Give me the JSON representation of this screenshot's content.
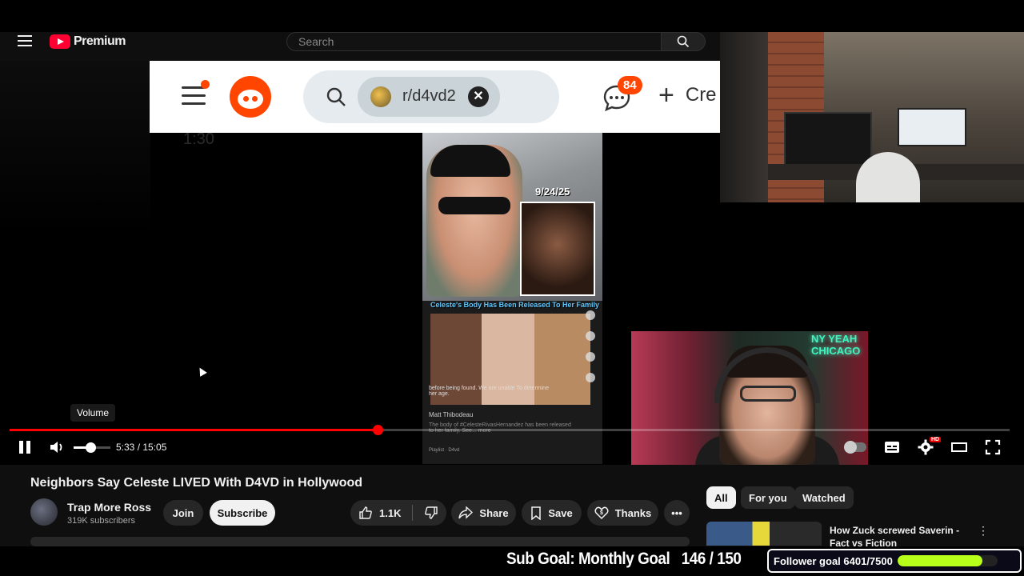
{
  "youtube": {
    "logo_text": "Premium",
    "search_placeholder": "Search"
  },
  "reddit": {
    "chip_label": "r/d4vd2",
    "notification_count": "84",
    "create_label": "Cre"
  },
  "video": {
    "ghost_time": "1:30",
    "tiktok": {
      "date": "9/24/25",
      "caption": "Celeste's Body Has Been Released To Her Family",
      "text_overlay": "before being found. We are unable To determine her age.",
      "username": "Matt Thibodeau",
      "body": "The body of #CelesteRivasHernandez has been released to her family. See... more",
      "bottom": "Playlist · D4vd"
    },
    "webcam_neon": "NY YEAH CHICAGO"
  },
  "player": {
    "tooltip": "Volume",
    "time_display": "5:33 / 15:05",
    "progress_fraction": 0.368,
    "volume_fraction": 0.45,
    "hd_badge": "HD"
  },
  "below": {
    "title": "Neighbors Say Celeste LIVED With D4VD in Hollywood",
    "channel_name": "Trap More Ross",
    "subscribers": "319K subscribers",
    "join_label": "Join",
    "subscribe_label": "Subscribe",
    "like_count": "1.1K",
    "share_label": "Share",
    "save_label": "Save",
    "thanks_label": "Thanks",
    "chips": [
      "All",
      "For you",
      "Watched"
    ],
    "rec_title": "How Zuck screwed Saverin - Fact vs Fiction"
  },
  "overlay": {
    "sub_goal_label": "Sub Goal: Monthly Goal",
    "sub_goal_count": "146 / 150",
    "follower_label": "Follower goal 6401/7500",
    "follower_fraction": 0.853,
    "follower_color": "#b7ff1a"
  },
  "colors": {
    "accent_red": "#ff0000",
    "reddit_orange": "#ff4500"
  }
}
